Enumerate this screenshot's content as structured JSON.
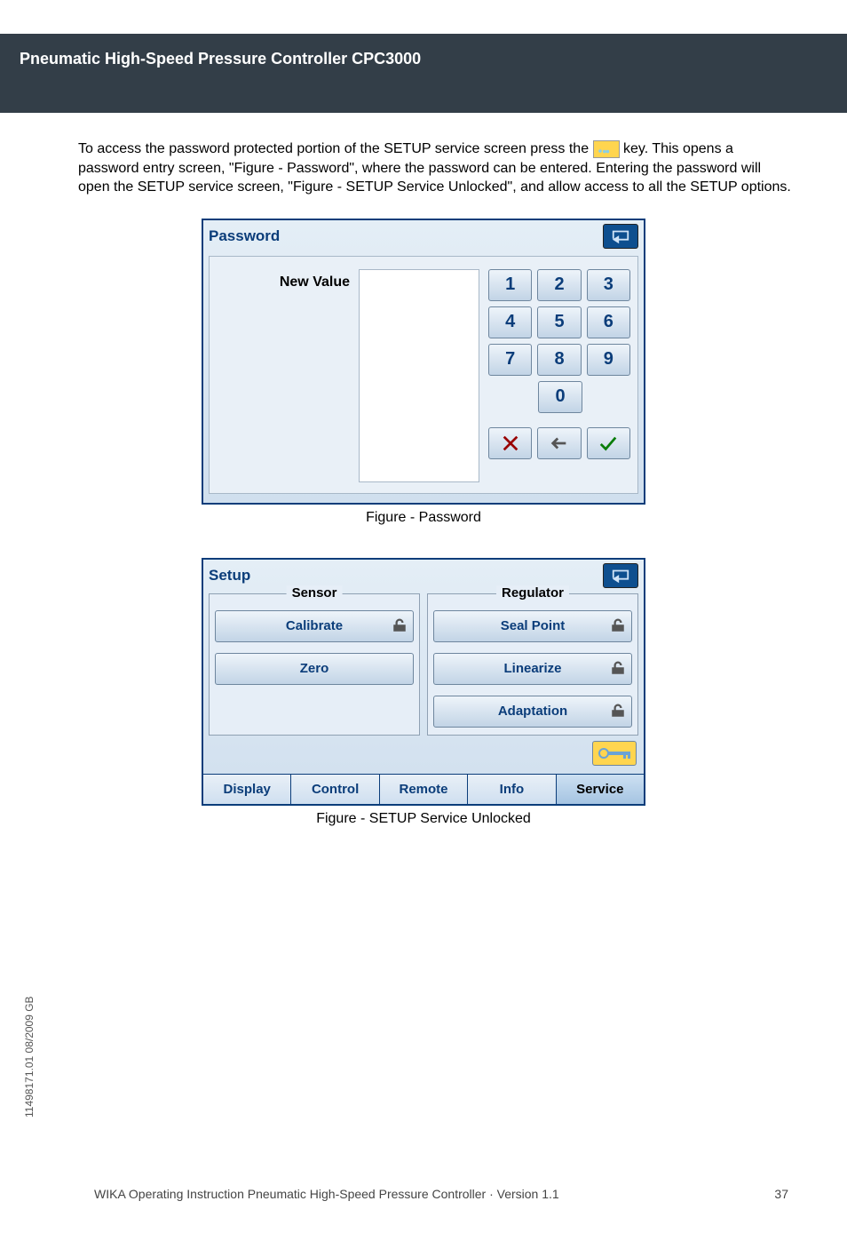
{
  "header": "Pneumatic High-Speed Pressure Controller CPC3000",
  "para_before_key": "To access the password protected portion of the SETUP service screen press the ",
  "para_after_key": " key. This opens a password entry screen, \"Figure - Password\", where the password can be entered. Entering the password will open the SETUP service screen, \"Figure - SETUP Service Unlocked\", and allow access to all the SETUP options.",
  "password_panel": {
    "title": "Password",
    "new_value_label": "New Value",
    "keys": [
      "1",
      "2",
      "3",
      "4",
      "5",
      "6",
      "7",
      "8",
      "9",
      "0"
    ]
  },
  "fig1_caption": "Figure - Password",
  "setup_panel": {
    "title": "Setup",
    "sensor_legend": "Sensor",
    "regulator_legend": "Regulator",
    "sensor_buttons": {
      "calibrate": "Calibrate",
      "zero": "Zero"
    },
    "regulator_buttons": {
      "seal": "Seal Point",
      "linearize": "Linearize",
      "adaptation": "Adaptation"
    },
    "tabs": {
      "display": "Display",
      "control": "Control",
      "remote": "Remote",
      "info": "Info",
      "service": "Service"
    }
  },
  "fig2_caption": "Figure - SETUP Service Unlocked",
  "side_text": "11498171.01 08/2009 GB",
  "footer_left": "WIKA Operating Instruction Pneumatic High-Speed Pressure Controller · Version 1.1",
  "footer_right": "37"
}
